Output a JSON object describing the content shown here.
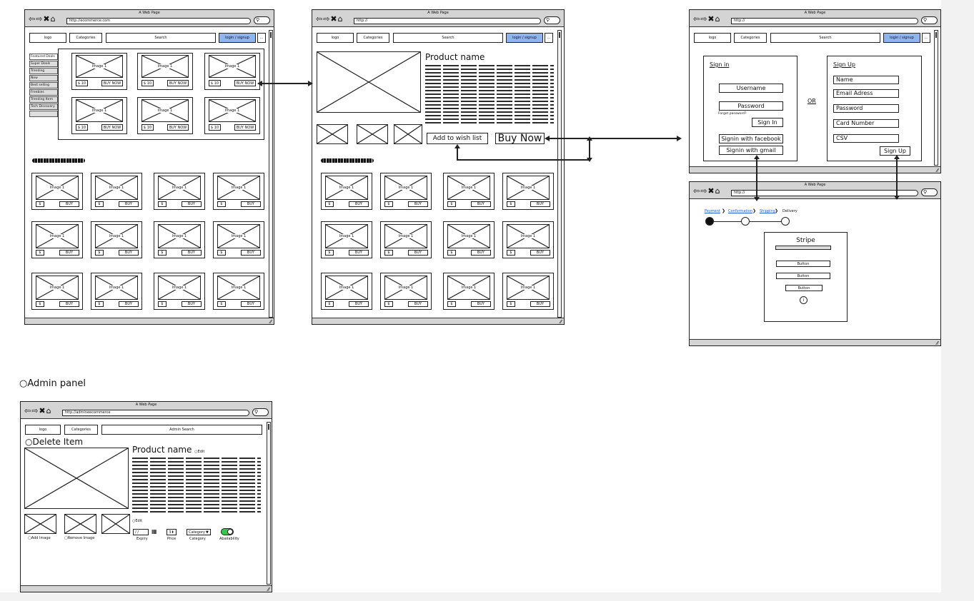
{
  "browser": {
    "title": "A Web Page"
  },
  "home": {
    "url": "http://ecommerce.com",
    "logo": "logo",
    "categories": "Categories",
    "search": "Search",
    "login": "login / signup",
    "more": "...",
    "sidebar": [
      "Featured Deals",
      "Super Deals",
      "Trending",
      "New",
      "Best selling",
      "Freebies",
      "Trending Item",
      "Tech Discovery"
    ],
    "image_label": "Image 1",
    "price": "$ 10",
    "buy_now": "BUY NOW",
    "grid_price": "$",
    "grid_buy": "BUY"
  },
  "product": {
    "url": "http://",
    "logo": "logo",
    "categories": "Categories",
    "search": "Search",
    "login": "login / signup",
    "more": "...",
    "name": "Product name",
    "wishlist": "Add to wish list",
    "buy_now": "Buy Now",
    "image_label": "Image 1",
    "grid_price": "$",
    "grid_buy": "BUY"
  },
  "auth": {
    "url": "http://",
    "logo": "logo",
    "categories": "Categories",
    "search": "Search",
    "login": "login / signup",
    "more": "...",
    "sign_in": {
      "title": "Sign in",
      "username": "Username",
      "password": "Password",
      "forgot": "Forgot password?",
      "button": "Sign In",
      "facebook": "Signin with facebook",
      "gmail": "Signin with gmail"
    },
    "or": "OR",
    "sign_up": {
      "title": "Sign Up",
      "name": "Name",
      "email": "Email Adress",
      "password": "Password",
      "card": "Card Number",
      "csv": "CSV",
      "button": "Sign Up"
    }
  },
  "checkout": {
    "url": "http://",
    "steps": [
      "Payment",
      "Conformation",
      "Shipping",
      "Delivery"
    ],
    "stripe_title": "Stripe",
    "buttons": [
      "Button",
      "Button",
      "Button"
    ]
  },
  "admin_section_label": "Admin panel",
  "admin": {
    "url": "http://admineecommerce",
    "logo": "logo",
    "categories": "Categories",
    "search": "Admin Search",
    "delete_item": "Delete Item",
    "product_name": "Product name",
    "edit": "Edit",
    "add_image": "Add Image",
    "remove_image": "Remove Image",
    "date_value": "/ /",
    "expiry": "Expiry",
    "price_value": "3",
    "price": "Price",
    "category_value": "Category",
    "category": "Category",
    "availability": "Abailability",
    "availability_on": true
  },
  "colors": {
    "accent": "#8fb4ee",
    "toggle_on": "#3cc44a",
    "chrome": "#d4d4d4"
  }
}
